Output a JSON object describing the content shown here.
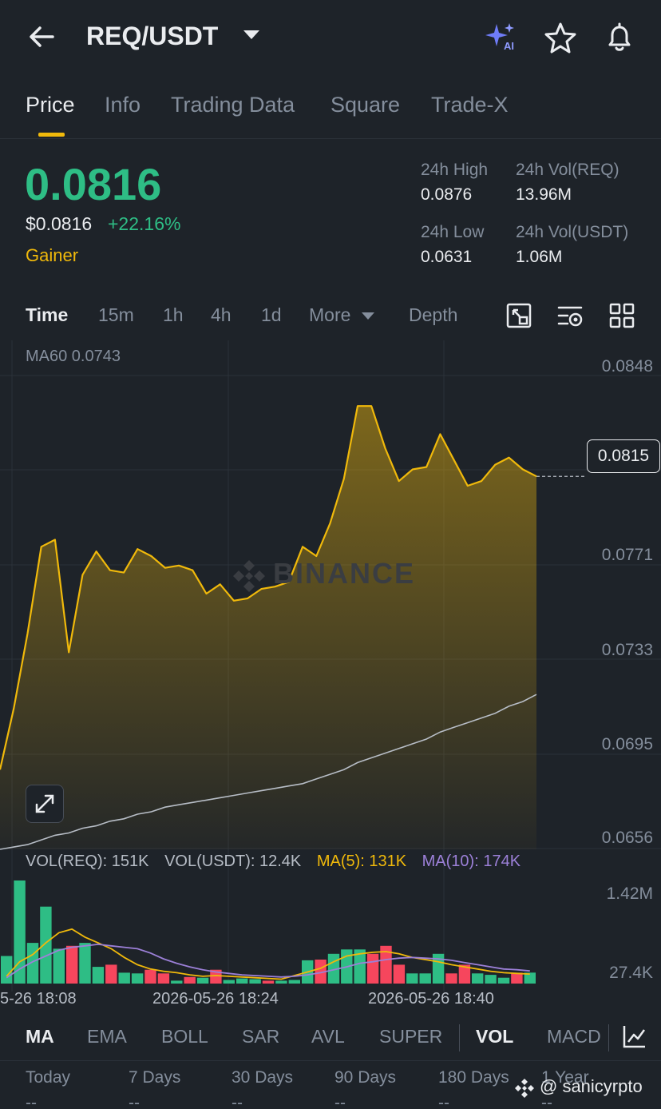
{
  "header": {
    "pair": "REQ/USDT",
    "icons": [
      "back-arrow-icon",
      "caret-down-icon",
      "ai-sparkle-icon",
      "star-icon",
      "bell-icon"
    ]
  },
  "tabs": [
    {
      "label": "Price",
      "active": true
    },
    {
      "label": "Info"
    },
    {
      "label": "Trading Data"
    },
    {
      "label": "Square"
    },
    {
      "label": "Trade-X"
    }
  ],
  "price": {
    "last": "0.0816",
    "usd": "$0.0816",
    "change": "+22.16%",
    "tag": "Gainer",
    "up_color": "#2ebd85",
    "down_color": "#f6465d",
    "accent": "#f0b90b"
  },
  "stats": {
    "high_label": "24h High",
    "high": "0.0876",
    "vol_base_label": "24h Vol(REQ)",
    "vol_base": "13.96M",
    "low_label": "24h Low",
    "low": "0.0631",
    "vol_quote_label": "24h Vol(USDT)",
    "vol_quote": "1.06M"
  },
  "timeframes": {
    "items": [
      "Time",
      "15m",
      "1h",
      "4h",
      "1d",
      "More",
      "Depth"
    ],
    "active": "Time",
    "tools": [
      "fullscreen-icon",
      "chart-settings-icon",
      "grid-layout-icon"
    ]
  },
  "chart": {
    "ma60_label": "MA60 0.0743",
    "last_price_tag": "0.0815",
    "watermark": "BINANCE",
    "price_axis": [
      "0.0848",
      "0.0771",
      "0.0733",
      "0.0695",
      "0.0656"
    ],
    "vol_axis": [
      "1.42M",
      "27.4K"
    ],
    "x_labels": [
      "5-26 18:08",
      "2026-05-26 18:24",
      "2026-05-26 18:40"
    ],
    "vol_legend": {
      "req": "VOL(REQ): 151K",
      "usdt": "VOL(USDT): 12.4K",
      "ma5": "MA(5): 131K",
      "ma10": "MA(10): 174K"
    }
  },
  "chart_data": {
    "type": "area",
    "ylim": [
      0.0656,
      0.0858
    ],
    "price": [
      0.069,
      0.0716,
      0.0748,
      0.0785,
      0.0788,
      0.074,
      0.0773,
      0.0783,
      0.0775,
      0.0774,
      0.0784,
      0.0781,
      0.0776,
      0.0777,
      0.0775,
      0.0765,
      0.0769,
      0.0762,
      0.0763,
      0.0767,
      0.0768,
      0.077,
      0.0785,
      0.0781,
      0.0795,
      0.0814,
      0.0845,
      0.0845,
      0.0827,
      0.0813,
      0.0818,
      0.0819,
      0.0833,
      0.0822,
      0.0811,
      0.0813,
      0.082,
      0.0823,
      0.0818,
      0.0815
    ],
    "ma60": [
      0.0656,
      0.0657,
      0.0658,
      0.066,
      0.0662,
      0.0663,
      0.0665,
      0.0666,
      0.0668,
      0.0669,
      0.0671,
      0.0672,
      0.0674,
      0.0675,
      0.0676,
      0.0677,
      0.0678,
      0.0679,
      0.068,
      0.0681,
      0.0682,
      0.0683,
      0.0684,
      0.0686,
      0.0688,
      0.069,
      0.0693,
      0.0695,
      0.0697,
      0.0699,
      0.0701,
      0.0703,
      0.0706,
      0.0708,
      0.071,
      0.0712,
      0.0714,
      0.0717,
      0.0719,
      0.0722
    ],
    "volume": {
      "ylim": [
        0,
        1420000
      ],
      "bars": [
        {
          "v": 380000,
          "up": true
        },
        {
          "v": 1420000,
          "up": true
        },
        {
          "v": 560000,
          "up": true
        },
        {
          "v": 1060000,
          "up": true
        },
        {
          "v": 480000,
          "up": true
        },
        {
          "v": 520000,
          "up": false
        },
        {
          "v": 560000,
          "up": true
        },
        {
          "v": 230000,
          "up": true
        },
        {
          "v": 260000,
          "up": false
        },
        {
          "v": 150000,
          "up": true
        },
        {
          "v": 140000,
          "up": true
        },
        {
          "v": 190000,
          "up": false
        },
        {
          "v": 140000,
          "up": false
        },
        {
          "v": 40000,
          "up": true
        },
        {
          "v": 90000,
          "up": false
        },
        {
          "v": 80000,
          "up": true
        },
        {
          "v": 190000,
          "up": false
        },
        {
          "v": 50000,
          "up": true
        },
        {
          "v": 70000,
          "up": true
        },
        {
          "v": 60000,
          "up": true
        },
        {
          "v": 40000,
          "up": false
        },
        {
          "v": 40000,
          "up": true
        },
        {
          "v": 50000,
          "up": true
        },
        {
          "v": 320000,
          "up": true
        },
        {
          "v": 330000,
          "up": false
        },
        {
          "v": 410000,
          "up": true
        },
        {
          "v": 470000,
          "up": true
        },
        {
          "v": 470000,
          "up": true
        },
        {
          "v": 410000,
          "up": false
        },
        {
          "v": 520000,
          "up": false
        },
        {
          "v": 260000,
          "up": false
        },
        {
          "v": 140000,
          "up": true
        },
        {
          "v": 140000,
          "up": true
        },
        {
          "v": 410000,
          "up": true
        },
        {
          "v": 140000,
          "up": false
        },
        {
          "v": 260000,
          "up": false
        },
        {
          "v": 140000,
          "up": true
        },
        {
          "v": 120000,
          "up": true
        },
        {
          "v": 80000,
          "up": true
        },
        {
          "v": 150000,
          "up": false
        },
        {
          "v": 151000,
          "up": true
        }
      ],
      "ma5": [
        100000,
        300000,
        400000,
        560000,
        700000,
        750000,
        640000,
        560000,
        480000,
        360000,
        260000,
        200000,
        170000,
        150000,
        120000,
        100000,
        110000,
        100000,
        90000,
        80000,
        70000,
        60000,
        110000,
        160000,
        210000,
        300000,
        380000,
        410000,
        430000,
        440000,
        410000,
        360000,
        330000,
        300000,
        260000,
        230000,
        200000,
        170000,
        150000,
        140000,
        131000
      ],
      "ma10": [
        80000,
        200000,
        300000,
        380000,
        460000,
        500000,
        520000,
        540000,
        520000,
        500000,
        480000,
        420000,
        340000,
        280000,
        230000,
        190000,
        160000,
        140000,
        120000,
        110000,
        100000,
        90000,
        100000,
        120000,
        150000,
        190000,
        230000,
        280000,
        300000,
        330000,
        350000,
        360000,
        350000,
        340000,
        320000,
        290000,
        260000,
        230000,
        200000,
        190000,
        174000
      ]
    },
    "xlabel": "",
    "ylabel": ""
  },
  "indicators": {
    "items": [
      "MA",
      "EMA",
      "BOLL",
      "SAR",
      "AVL",
      "SUPER",
      "VOL",
      "MACD"
    ],
    "active_main": "MA",
    "active_sub": "VOL"
  },
  "performance": {
    "periods": [
      "Today",
      "7 Days",
      "30 Days",
      "90 Days",
      "180 Days",
      "1 Year"
    ],
    "values": [
      "--",
      "--",
      "--",
      "--",
      "--",
      "--"
    ]
  },
  "credit": "@ sanicyrpto"
}
